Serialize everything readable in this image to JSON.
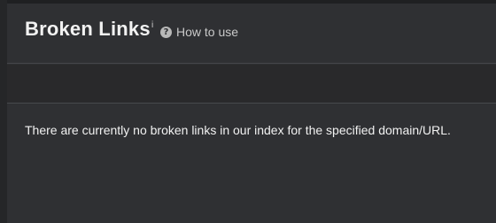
{
  "header": {
    "title": "Broken Links",
    "info_marker": "i",
    "help_icon": "question-circle-icon",
    "help_label": "How to use"
  },
  "content": {
    "message": "There are currently no broken links in our index for the specified domain/URL."
  }
}
